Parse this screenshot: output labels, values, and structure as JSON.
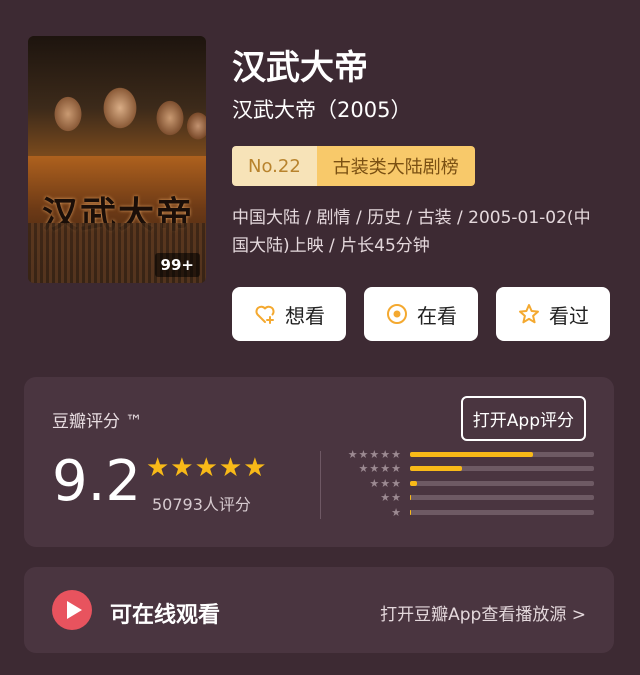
{
  "movie": {
    "title": "汉武大帝",
    "subtitle": "汉武大帝（2005）",
    "poster_count": "99+",
    "poster_title_art": "汉武大帝",
    "rank_number": "No.22",
    "rank_category": "古装类大陆剧榜",
    "meta": "中国大陆 / 剧情 / 历史 / 古装 / 2005-01-02(中国大陆)上映 / 片长45分钟"
  },
  "actions": {
    "want_label": "想看",
    "watching_label": "在看",
    "watched_label": "看过"
  },
  "rating": {
    "label": "豆瓣评分 ™",
    "open_app_label": "打开App评分",
    "score": "9.2",
    "stars_display": "★★★★★",
    "votes": "50793人评分",
    "distribution": [
      {
        "stars": "★★★★★",
        "fraction": 0.67
      },
      {
        "stars": "★★★★",
        "fraction": 0.28
      },
      {
        "stars": "★★★",
        "fraction": 0.04
      },
      {
        "stars": "★★",
        "fraction": 0.005
      },
      {
        "stars": "★",
        "fraction": 0.005
      }
    ]
  },
  "online": {
    "label": "可在线观看",
    "link_label": "打开豆瓣App查看播放源 >"
  },
  "colors": {
    "background": "#3d2a33",
    "card": "#4a3540",
    "star": "#f8b918",
    "play": "#e8535e"
  },
  "icons": [
    "heart-plus-icon",
    "target-icon",
    "star-outline-icon",
    "play-icon"
  ]
}
